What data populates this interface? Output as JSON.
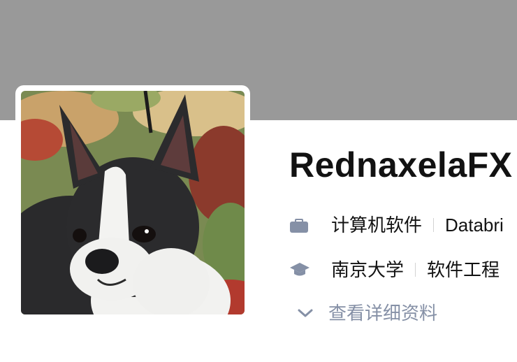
{
  "profile": {
    "name": "RednaxelaFX",
    "work": {
      "industry": "计算机软件",
      "company": "Databri"
    },
    "education": {
      "school": "南京大学",
      "major": "软件工程"
    },
    "more_label": "查看详细资料",
    "icons": {
      "work": "briefcase-icon",
      "education": "graduation-cap-icon",
      "more": "chevron-down-icon"
    }
  },
  "colors": {
    "cover": "#999999",
    "text": "#121212",
    "muted": "#8590a6"
  }
}
